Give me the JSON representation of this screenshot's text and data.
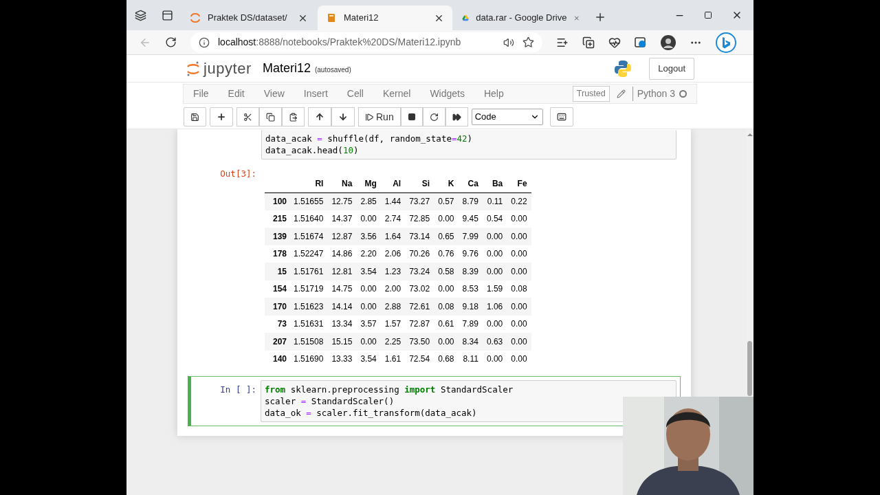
{
  "browser": {
    "tabs": [
      {
        "title": "Praktek DS/dataset/",
        "selected": false
      },
      {
        "title": "Materi12",
        "selected": true
      },
      {
        "title": "data.rar - Google Drive",
        "selected": false
      }
    ],
    "address": {
      "host": "localhost",
      "path": ":8888/notebooks/Praktek%20DS/Materi12.ipynb"
    }
  },
  "notebook": {
    "brand": "jupyter",
    "title": "Materi12",
    "save_status": "(autosaved)",
    "logout": "Logout",
    "menu": [
      "File",
      "Edit",
      "View",
      "Insert",
      "Cell",
      "Kernel",
      "Widgets",
      "Help"
    ],
    "trusted": "Trusted",
    "kernel": "Python 3",
    "kernel_busy": false,
    "run": "Run",
    "cell_type": "Code"
  },
  "cells": [
    {
      "selected": false,
      "lines": [
        [
          {
            "t": "data_acak ",
            "kind": "plain"
          },
          {
            "t": "=",
            "kind": "op"
          },
          {
            "t": " shuffle(df, random_state",
            "kind": "plain"
          },
          {
            "t": "=",
            "kind": "op"
          },
          {
            "t": "42",
            "kind": "num"
          },
          {
            "t": ")",
            "kind": "plain"
          }
        ],
        [
          {
            "t": "data_acak.head(",
            "kind": "plain"
          },
          {
            "t": "10",
            "kind": "num"
          },
          {
            "t": ")",
            "kind": "plain"
          }
        ]
      ],
      "output": {
        "prompt": "Out[3]:",
        "columns": [
          "RI",
          "Na",
          "Mg",
          "Al",
          "Si",
          "K",
          "Ca",
          "Ba",
          "Fe"
        ],
        "rows": [
          {
            "index": "100",
            "values": [
              "1.51655",
              "12.75",
              "2.85",
              "1.44",
              "73.27",
              "0.57",
              "8.79",
              "0.11",
              "0.22"
            ]
          },
          {
            "index": "215",
            "values": [
              "1.51640",
              "14.37",
              "0.00",
              "2.74",
              "72.85",
              "0.00",
              "9.45",
              "0.54",
              "0.00"
            ]
          },
          {
            "index": "139",
            "values": [
              "1.51674",
              "12.87",
              "3.56",
              "1.64",
              "73.14",
              "0.65",
              "7.99",
              "0.00",
              "0.00"
            ]
          },
          {
            "index": "178",
            "values": [
              "1.52247",
              "14.86",
              "2.20",
              "2.06",
              "70.26",
              "0.76",
              "9.76",
              "0.00",
              "0.00"
            ]
          },
          {
            "index": "15",
            "values": [
              "1.51761",
              "12.81",
              "3.54",
              "1.23",
              "73.24",
              "0.58",
              "8.39",
              "0.00",
              "0.00"
            ]
          },
          {
            "index": "154",
            "values": [
              "1.51719",
              "14.75",
              "0.00",
              "2.00",
              "73.02",
              "0.00",
              "8.53",
              "1.59",
              "0.08"
            ]
          },
          {
            "index": "170",
            "values": [
              "1.51623",
              "14.14",
              "0.00",
              "2.88",
              "72.61",
              "0.08",
              "9.18",
              "1.06",
              "0.00"
            ]
          },
          {
            "index": "73",
            "values": [
              "1.51631",
              "13.34",
              "3.57",
              "1.57",
              "72.87",
              "0.61",
              "7.89",
              "0.00",
              "0.00"
            ]
          },
          {
            "index": "207",
            "values": [
              "1.51508",
              "15.15",
              "0.00",
              "2.25",
              "73.50",
              "0.00",
              "8.34",
              "0.63",
              "0.00"
            ]
          },
          {
            "index": "140",
            "values": [
              "1.51690",
              "13.33",
              "3.54",
              "1.61",
              "72.54",
              "0.68",
              "8.11",
              "0.00",
              "0.00"
            ]
          }
        ]
      }
    },
    {
      "prompt": "In [ ]:",
      "selected": true,
      "lines": [
        [
          {
            "t": "from",
            "kind": "kw"
          },
          {
            "t": " sklearn.preprocessing ",
            "kind": "plain"
          },
          {
            "t": "import",
            "kind": "kw"
          },
          {
            "t": " StandardScaler",
            "kind": "plain"
          }
        ],
        [
          {
            "t": "scaler ",
            "kind": "plain"
          },
          {
            "t": "=",
            "kind": "op"
          },
          {
            "t": " StandardScaler()",
            "kind": "plain"
          }
        ],
        [
          {
            "t": "data_ok ",
            "kind": "plain"
          },
          {
            "t": "=",
            "kind": "op"
          },
          {
            "t": " scaler.fit_transform(data_acak)",
            "kind": "plain"
          }
        ]
      ]
    }
  ]
}
